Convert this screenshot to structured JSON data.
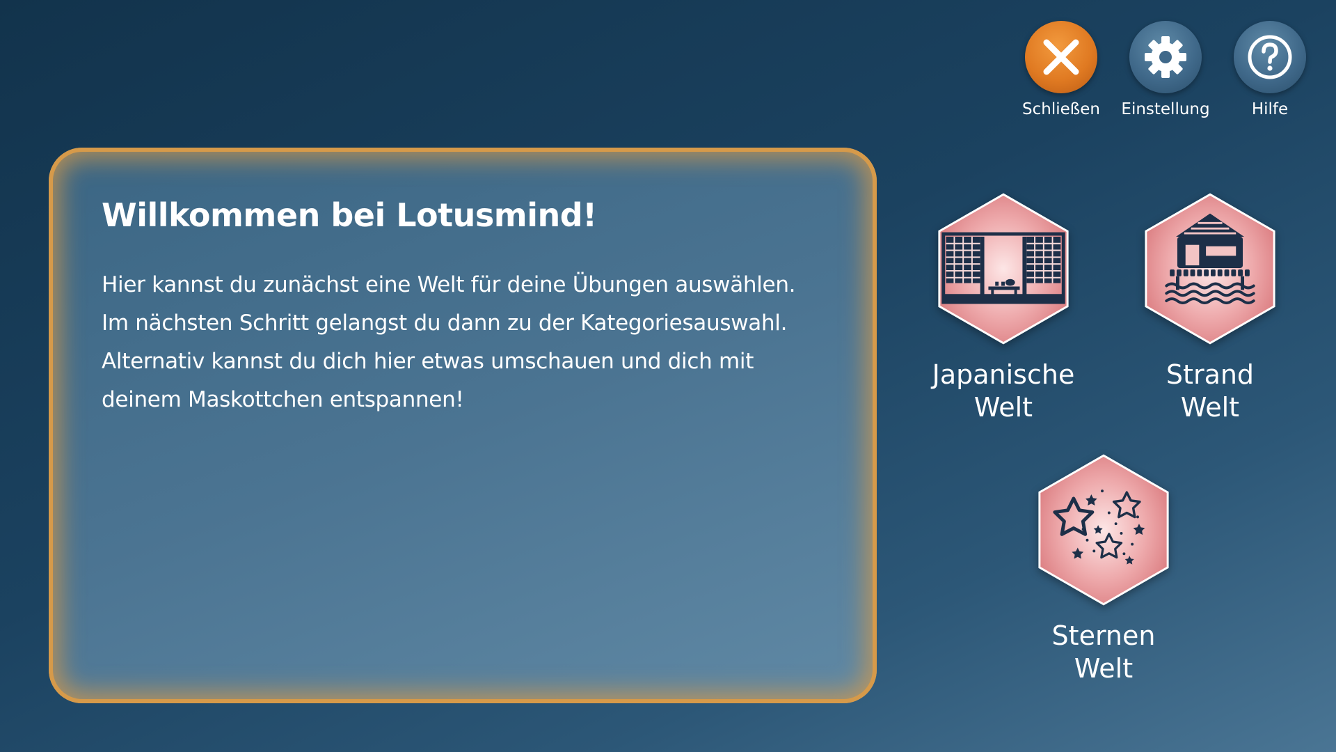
{
  "toolbar": {
    "close_label": "Schließen",
    "settings_label": "Einstellung",
    "help_label": "Hilfe"
  },
  "welcome": {
    "title": "Willkommen bei Lotusmind!",
    "lines": [
      "Hier kannst du zunächst eine Welt für deine Übungen auswählen.",
      "Im nächsten Schritt gelangst du dann zu der Kategoriesauswahl.",
      "Alternativ kannst du dich hier etwas umschauen und dich mit",
      "deinem Maskottchen entspannen!"
    ]
  },
  "worlds": [
    {
      "line1": "Japanische",
      "line2": "Welt",
      "icon": "japanese-room-icon"
    },
    {
      "line1": "Strand",
      "line2": "Welt",
      "icon": "beach-hut-icon"
    },
    {
      "line1": "Sternen",
      "line2": "Welt",
      "icon": "stars-icon"
    }
  ],
  "colors": {
    "accent_orange": "#e07a22",
    "card_border": "#d69a4a",
    "hex_pink": "#e89a9c",
    "icon_navy": "#1d2f48",
    "background_dark": "#12334c"
  }
}
